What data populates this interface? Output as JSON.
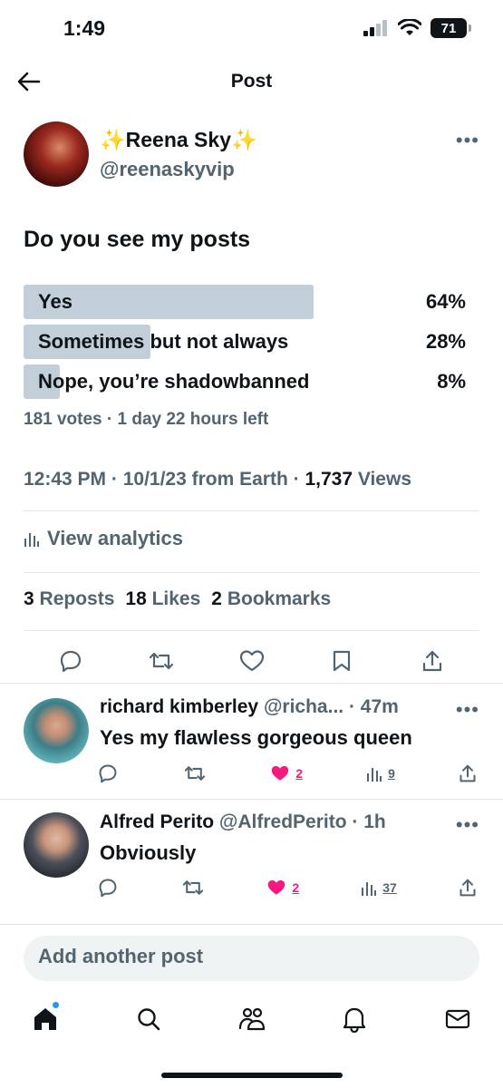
{
  "status_bar": {
    "time": "1:49",
    "battery": "71"
  },
  "header": {
    "title": "Post"
  },
  "post": {
    "author_name": "✨Reena Sky✨",
    "author_handle": "@reenaskyvip",
    "text": "Do you see my posts",
    "poll": {
      "options": [
        {
          "label": "Yes",
          "percent": "64%",
          "fraction": 0.64
        },
        {
          "label": "Sometimes but not always",
          "percent": "28%",
          "fraction": 0.28
        },
        {
          "label": "Nope, you’re shadowbanned",
          "percent": "8%",
          "fraction": 0.08
        }
      ],
      "meta": "181 votes · 1 day 22 hours left"
    },
    "timestamp": "12:43 PM · 10/1/23 from Earth · ",
    "views_count": "1,737",
    "views_label": " Views",
    "analytics_label": "View analytics",
    "stats": {
      "reposts_count": "3",
      "reposts_label": "Reposts",
      "likes_count": "18",
      "likes_label": "Likes",
      "bookmarks_count": "2",
      "bookmarks_label": "Bookmarks"
    }
  },
  "replies": [
    {
      "name": "richard kimberley",
      "meta": "@richa... · 47m",
      "text": "Yes my flawless gorgeous queen",
      "likes": "2",
      "views": "9"
    },
    {
      "name": "Alfred Perito",
      "meta": "@AlfredPerito · 1h",
      "text": "Obviously",
      "likes": "2",
      "views": "37"
    }
  ],
  "compose": {
    "placeholder": "Add another post"
  },
  "icons": {
    "back": "arrow-left-icon",
    "more": "more-dots-icon",
    "reply": "reply-icon",
    "repost": "repost-icon",
    "like": "heart-icon",
    "bookmark": "bookmark-icon",
    "share": "share-icon",
    "analytics": "analytics-icon",
    "home": "home-icon",
    "search": "search-icon",
    "communities": "communities-icon",
    "notifications": "bell-icon",
    "messages": "mail-icon"
  },
  "colors": {
    "accent": "#1d9bf0",
    "like": "#f91880",
    "secondary_text": "#536471",
    "poll_fill": "#c2ced8"
  }
}
